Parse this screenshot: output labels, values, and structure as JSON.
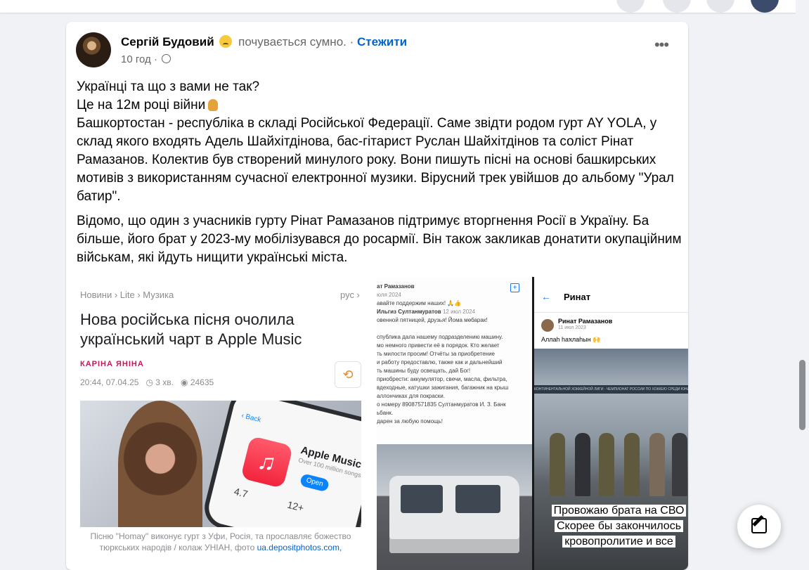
{
  "post": {
    "author": "Сергій Будовий",
    "feeling": "почувається сумно.",
    "separator": "·",
    "follow": "Стежити",
    "time": "10 год",
    "meta_sep": "·",
    "more": "•••",
    "lines": [
      "Українці та що з вами не так?",
      "Це на 12м році війни",
      "Башкортостан - республіка в складі Російської Федерації. Саме звідти родом гурт AY YOLA, у склад якого входять Адель Шайхітдінова, бас-гітарист Руслан Шайхітдінов та соліст Рінат Рамазанов. Колектив був створений минулого року. Вони пишуть пісні на основі башкирських мотивів з використанням сучасної електронної музики. Вірусний трек увійшов до альбому \"Урал батир\"."
    ],
    "paragraph2": "Відомо, що один з учасників гурту Рінат Рамазанов підтримує вторгнення Росії в Україну. Ба більше, його брат у 2023-му мобілізувався до росармії. Він також закликав донатити окупаційним військам, які йдуть нищити українські міста."
  },
  "article": {
    "crumbs": "Новини  ›  Lite  ›  Музика",
    "lang": "рус ›",
    "title": "Нова російська пісня очолила український чарт в Apple Music",
    "author": "КАРІНА ЯНІНА",
    "date": "20:44, 07.04.25",
    "read_time": "3 хв.",
    "views": "24635",
    "share_icon": "⟲",
    "phone": {
      "back": "‹ Back",
      "app_name": "Apple Music",
      "app_sub": "Over 100 million songs.",
      "open": "Open",
      "rating": "4.7",
      "age": "12+"
    },
    "caption": "Пісню \"Homay\" виконує гурт з Уфи, Росія, та прославляє божество тюркських народів / колаж УНІАН, фото",
    "caption_link": "ua.depositphotos.com,"
  },
  "screenshot": {
    "header": "ат Рамазанов",
    "header_date": "юля 2024",
    "line1": "авайте поддержим наших! 🙏👍",
    "author2": "Ильгиз Султанмуратов",
    "date2": "12 июл 2024",
    "body": "овенной пятницей, друзья! Йома мөбарак!\n\nспублика дала нашему подразделению машину.\nмо немного привести её в порядок. Кто желает\nть милости просим! Отчёты за приобретение\nи работу предоставлю, также как и дальнейший\nть машины буду освещать, дай Бог!\nприобрести: аккумулятор, свечи, масла, фильтра,\nвдеходные, катушки зажигания, багажник на крыш\nаллончиках для покраски.\nо номеру 89087571835 Султанмуратов И. З. Банк\nьбанк.\nдарен за любую помощь!"
  },
  "story": {
    "title": "Ринат",
    "back": "←",
    "name": "Ринат Рамазанов",
    "date": "11 июл 2023",
    "text": "Аллаh һаҡлаһын 🙌",
    "band": "КОНТИНЕНТАЛЬНОЙ ХОККЕЙНОЙ ЛИГИ - ЧЕМПИОНАТ РОССИИ ПО ХОККЕЮ СРЕДИ ЮНИОРСКИХ КОМАНД",
    "overlay": [
      "Провожаю брата на СВО",
      "Скорее бы закончилось",
      "кровопролитие и все"
    ]
  }
}
